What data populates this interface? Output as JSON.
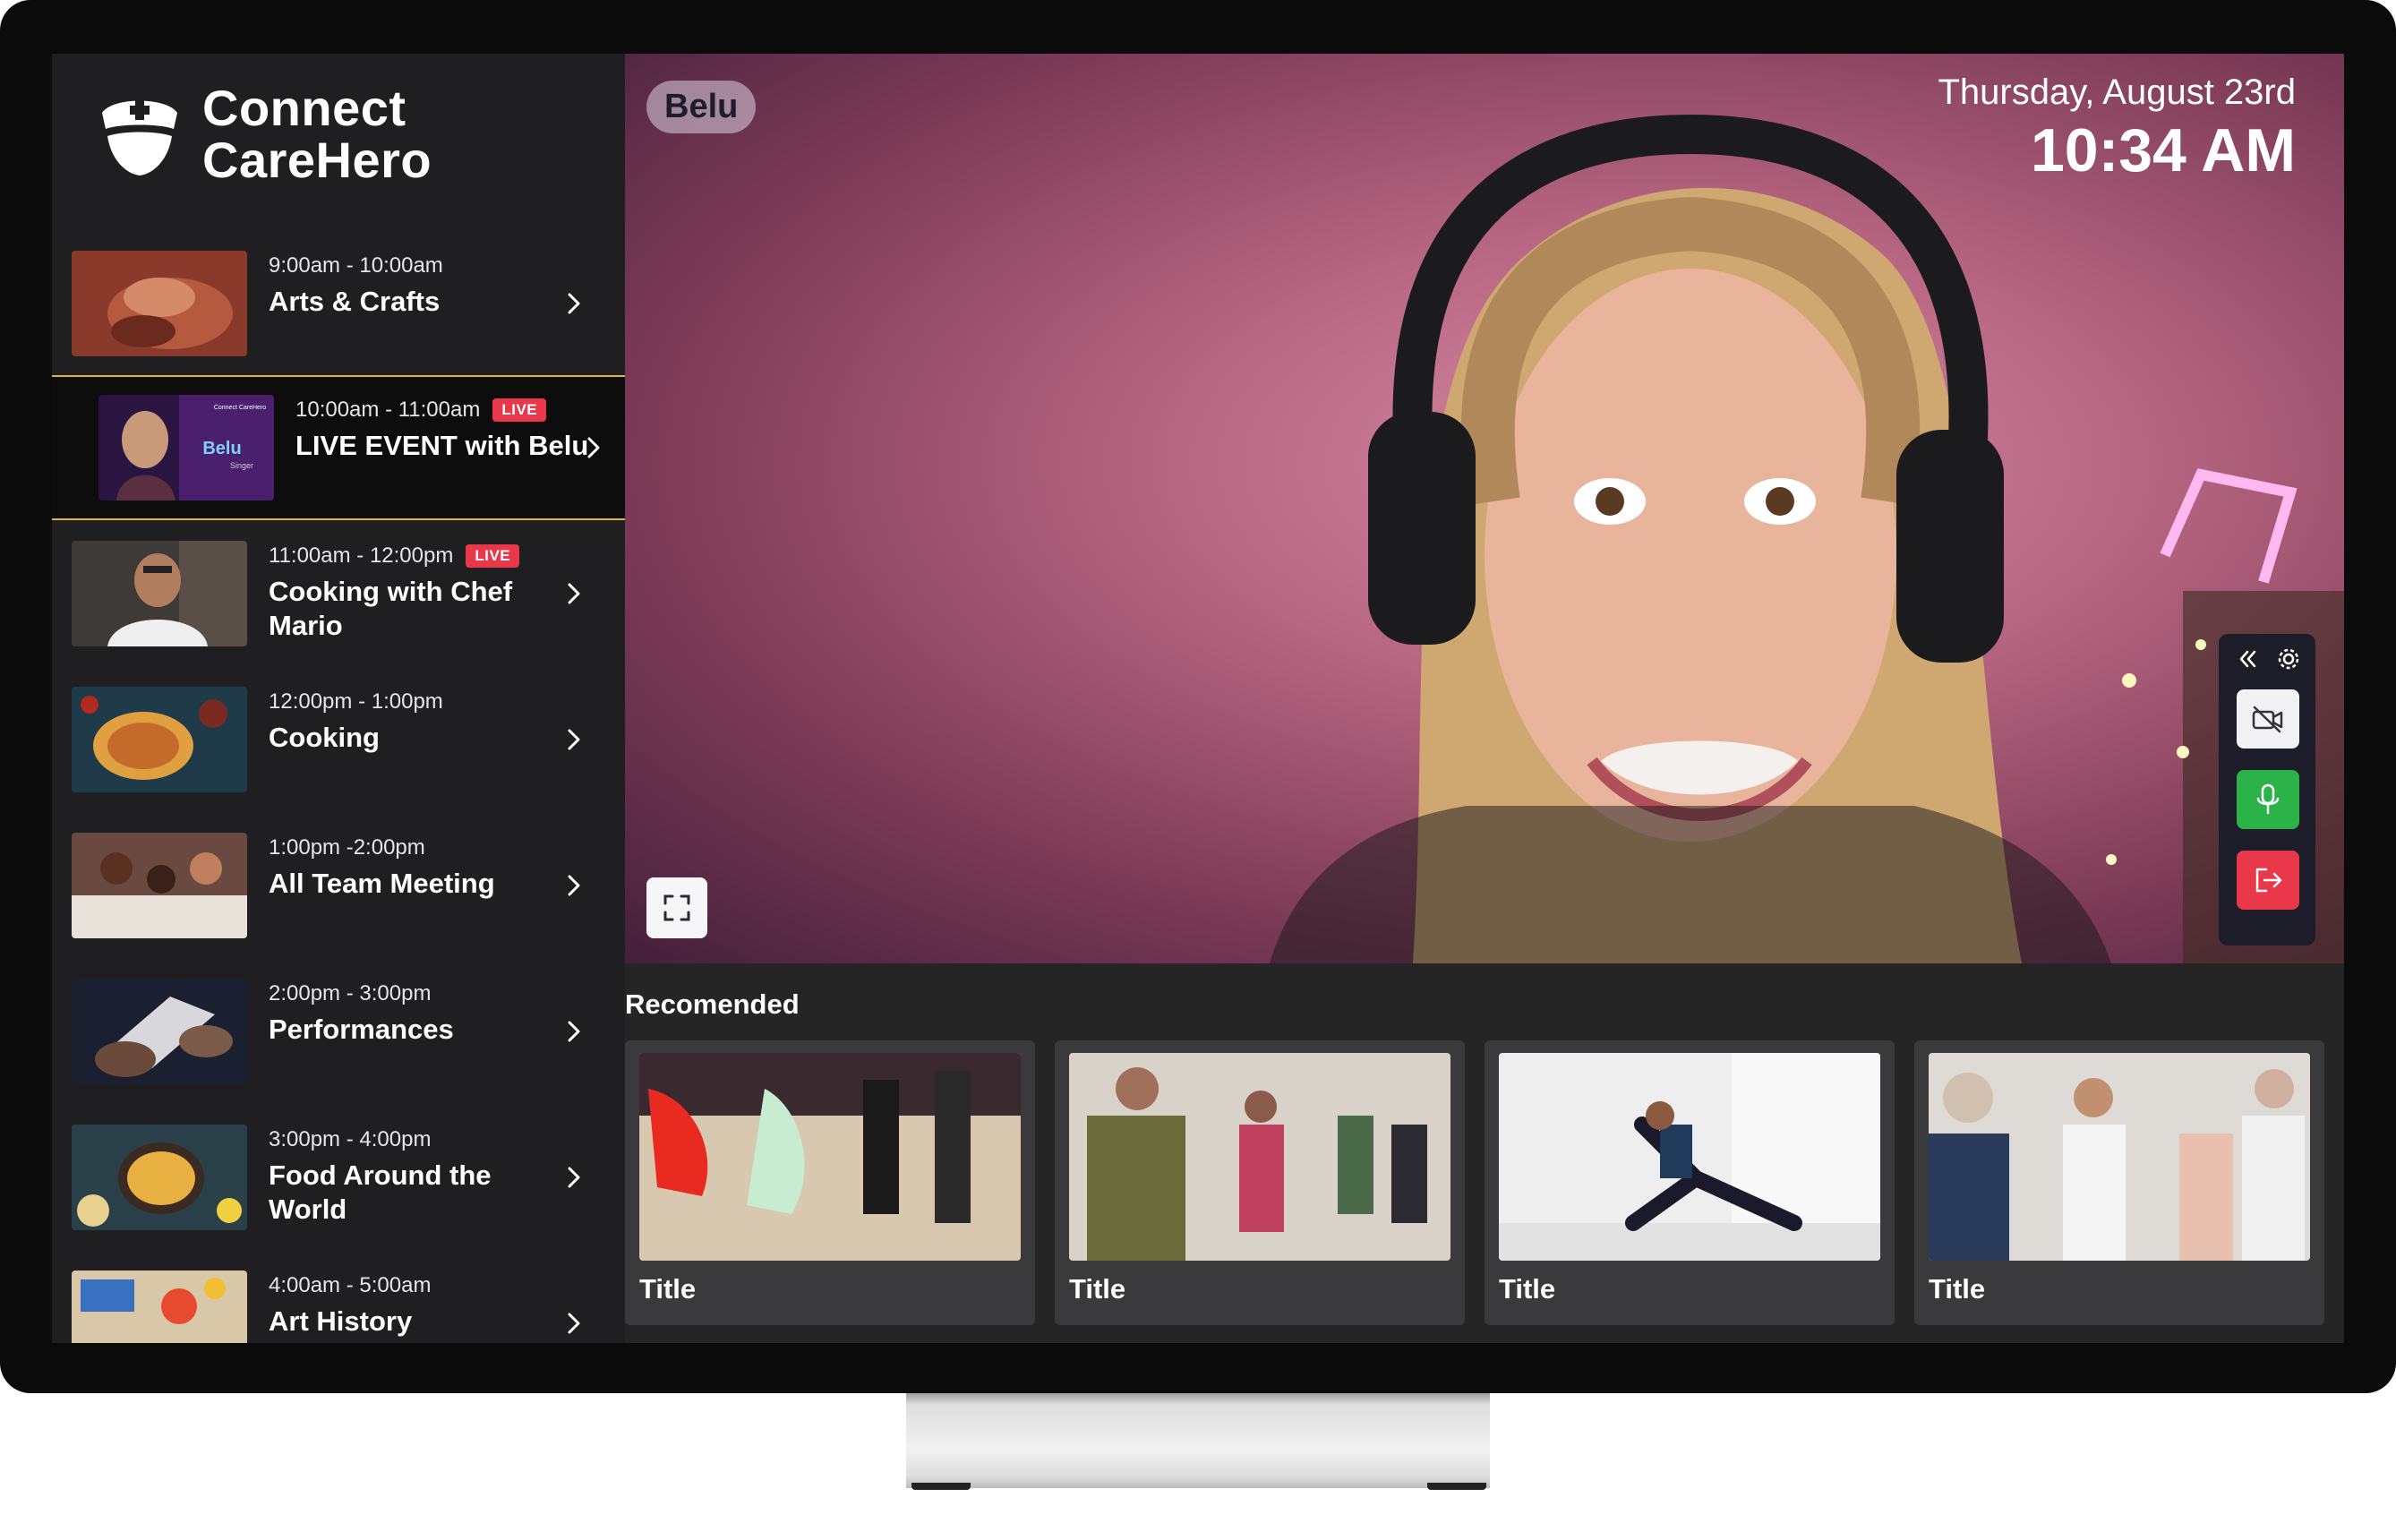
{
  "app": {
    "logo_line1": "Connect",
    "logo_line2": "CareHero"
  },
  "schedule": [
    {
      "time": "9:00am - 10:00am",
      "title": "Arts & Crafts",
      "live": false
    },
    {
      "time": "10:00am - 11:00am",
      "title": "LIVE EVENT with Belu",
      "live": true,
      "active": true,
      "thumb_label": "Belu",
      "thumb_sub": "Singer",
      "thumb_brand": "Connect CareHero"
    },
    {
      "time": "11:00am - 12:00pm",
      "title": "Cooking with Chef Mario",
      "live": true
    },
    {
      "time": "12:00pm - 1:00pm",
      "title": "Cooking",
      "live": false
    },
    {
      "time": "1:00pm -2:00pm",
      "title": "All Team Meeting",
      "live": false
    },
    {
      "time": "2:00pm - 3:00pm",
      "title": "Performances",
      "live": false
    },
    {
      "time": "3:00pm - 4:00pm",
      "title": "Food Around the World",
      "live": false
    },
    {
      "time": "4:00am - 5:00am",
      "title": "Art History",
      "live": false
    }
  ],
  "live_label": "LIVE",
  "video": {
    "presenter_name": "Belu",
    "date": "Thursday, August 23rd",
    "time": "10:34 AM"
  },
  "controls": [
    "collapse-icon",
    "settings-icon",
    "camera-off-icon",
    "microphone-icon",
    "leave-icon"
  ],
  "recommended": {
    "heading": "Recomended",
    "cards": [
      {
        "title": "Title"
      },
      {
        "title": "Title"
      },
      {
        "title": "Title"
      },
      {
        "title": "Title"
      }
    ]
  },
  "colors": {
    "live": "#e8384a",
    "active_border": "#e7b43a",
    "mic": "#2bb34a",
    "leave": "#e8384a"
  }
}
